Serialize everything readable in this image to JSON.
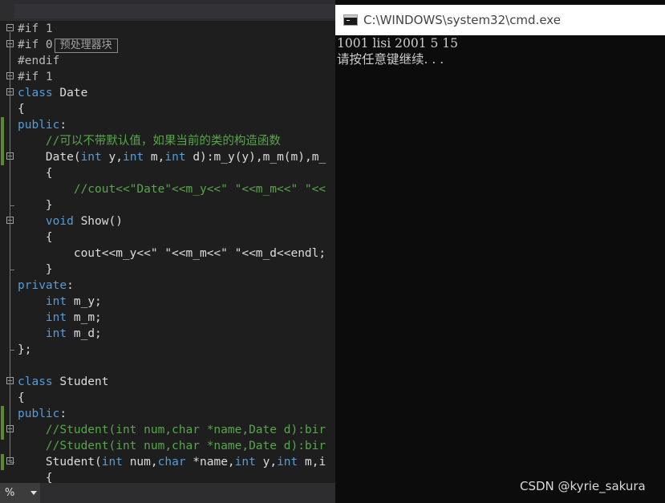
{
  "editor": {
    "lines": [
      {
        "segments": [
          {
            "t": "#if 1",
            "c": "pp"
          }
        ],
        "fold": "minus"
      },
      {
        "segments": [
          {
            "t": "#if 0",
            "c": "pp"
          }
        ],
        "fold": "plus",
        "collapsed": "预处理器块"
      },
      {
        "segments": [
          {
            "t": "#endif",
            "c": "pp"
          }
        ]
      },
      {
        "segments": [
          {
            "t": "#if 1",
            "c": "pp"
          }
        ],
        "fold": "minus"
      },
      {
        "segments": [
          {
            "t": "class",
            "c": "kw"
          },
          {
            "t": " Date",
            "c": "plain"
          }
        ],
        "fold": "minus"
      },
      {
        "segments": [
          {
            "t": "{",
            "c": "plain"
          }
        ]
      },
      {
        "segments": [
          {
            "t": "public",
            "c": "kw"
          },
          {
            "t": ":",
            "c": "plain"
          }
        ]
      },
      {
        "segments": [
          {
            "t": "    //可以不带默认值，如果当前的类的构造函数",
            "c": "cm"
          }
        ]
      },
      {
        "segments": [
          {
            "t": "    Date(",
            "c": "plain"
          },
          {
            "t": "int",
            "c": "kw"
          },
          {
            "t": " y,",
            "c": "plain"
          },
          {
            "t": "int",
            "c": "kw"
          },
          {
            "t": " m,",
            "c": "plain"
          },
          {
            "t": "int",
            "c": "kw"
          },
          {
            "t": " d):m_y(y),m_m(m),m_",
            "c": "plain"
          }
        ],
        "fold": "minus"
      },
      {
        "segments": [
          {
            "t": "    {",
            "c": "plain"
          }
        ]
      },
      {
        "segments": [
          {
            "t": "        //cout<<\"Date\"<<m_y<<\" \"<<m_m<<\" \"<<",
            "c": "cm"
          }
        ]
      },
      {
        "segments": [
          {
            "t": "    }",
            "c": "plain"
          }
        ]
      },
      {
        "segments": [
          {
            "t": "    ",
            "c": "plain"
          },
          {
            "t": "void",
            "c": "kw"
          },
          {
            "t": " Show()",
            "c": "plain"
          }
        ],
        "fold": "minus"
      },
      {
        "segments": [
          {
            "t": "    {",
            "c": "plain"
          }
        ]
      },
      {
        "segments": [
          {
            "t": "        cout<<m_y<<\" \"<<m_m<<\" \"<<m_d<<endl;",
            "c": "plain"
          }
        ]
      },
      {
        "segments": [
          {
            "t": "    }",
            "c": "plain"
          }
        ]
      },
      {
        "segments": [
          {
            "t": "private",
            "c": "kw"
          },
          {
            "t": ":",
            "c": "plain"
          }
        ]
      },
      {
        "segments": [
          {
            "t": "    ",
            "c": "plain"
          },
          {
            "t": "int",
            "c": "kw"
          },
          {
            "t": " m_y;",
            "c": "plain"
          }
        ]
      },
      {
        "segments": [
          {
            "t": "    ",
            "c": "plain"
          },
          {
            "t": "int",
            "c": "kw"
          },
          {
            "t": " m_m;",
            "c": "plain"
          }
        ]
      },
      {
        "segments": [
          {
            "t": "    ",
            "c": "plain"
          },
          {
            "t": "int",
            "c": "kw"
          },
          {
            "t": " m_d;",
            "c": "plain"
          }
        ]
      },
      {
        "segments": [
          {
            "t": "};",
            "c": "plain"
          }
        ]
      },
      {
        "segments": []
      },
      {
        "segments": [
          {
            "t": "class",
            "c": "kw"
          },
          {
            "t": " Student",
            "c": "plain"
          }
        ],
        "fold": "minus"
      },
      {
        "segments": [
          {
            "t": "{",
            "c": "plain"
          }
        ]
      },
      {
        "segments": [
          {
            "t": "public",
            "c": "kw"
          },
          {
            "t": ":",
            "c": "plain"
          }
        ]
      },
      {
        "segments": [
          {
            "t": "    //Student(int num,char *name,Date d):bir",
            "c": "cm"
          }
        ],
        "fold": "minus"
      },
      {
        "segments": [
          {
            "t": "    //Student(int num,char *name,Date d):bir",
            "c": "cm"
          }
        ]
      },
      {
        "segments": [
          {
            "t": "    Student(",
            "c": "plain"
          },
          {
            "t": "int",
            "c": "kw"
          },
          {
            "t": " num,",
            "c": "plain"
          },
          {
            "t": "char",
            "c": "kw"
          },
          {
            "t": " *name,",
            "c": "plain"
          },
          {
            "t": "int",
            "c": "kw"
          },
          {
            "t": " y,",
            "c": "plain"
          },
          {
            "t": "int",
            "c": "kw"
          },
          {
            "t": " m,i",
            "c": "plain"
          }
        ],
        "fold": "minus"
      },
      {
        "segments": [
          {
            "t": "    {",
            "c": "plain"
          }
        ]
      }
    ],
    "zoom_label": "%"
  },
  "console": {
    "title": "C:\\WINDOWS\\system32\\cmd.exe",
    "output": [
      "1001 lisi 2001 5 15",
      "请按任意键继续. . ."
    ]
  },
  "watermark": "CSDN @kyrie_sakura"
}
